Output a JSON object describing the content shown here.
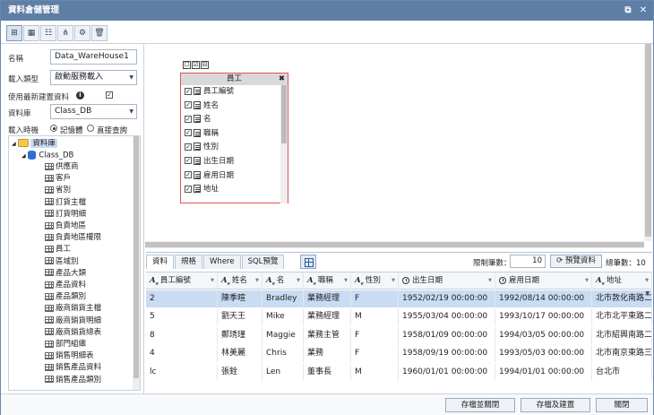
{
  "window": {
    "title": "資料倉儲管理"
  },
  "form": {
    "name_label": "名稱",
    "name_value": "Data_WareHouse1",
    "import_type_label": "載入類型",
    "import_type_value": "啟動服務載入",
    "use_latest_label": "使用最新建置資料",
    "use_latest_checked": "✓",
    "database_label": "資料庫",
    "database_value": "Class_DB",
    "import_timing_label": "載入時機",
    "radio_memory": "記憶體",
    "radio_direct": "直接查詢"
  },
  "tree": {
    "root": "資料庫",
    "db": "Class_DB",
    "tables": [
      "供應商",
      "客戶",
      "省別",
      "訂貨主檔",
      "訂貨明細",
      "負責地區",
      "負責地區權限",
      "員工",
      "區域別",
      "產品大類",
      "產品資料",
      "產品類別",
      "廠商銷貨主檔",
      "廠商銷貨明細",
      "廠商銷貨總表",
      "部門組織",
      "銷售明細表",
      "銷售產品資料",
      "銷售產品類別"
    ]
  },
  "canvas": {
    "mini_icons": [
      "☐",
      "☑",
      "⊟"
    ],
    "table_box": {
      "title": "員工",
      "close": "✖",
      "fields": [
        "員工編號",
        "姓名",
        "名",
        "職稱",
        "性別",
        "出生日期",
        "雇用日期",
        "地址"
      ]
    }
  },
  "bottom": {
    "tabs": [
      "資料",
      "規格",
      "Where",
      "SQL預覽"
    ],
    "limit_label": "限制筆數：",
    "limit_value": "10",
    "preview_button": "預覽資料",
    "preview_icon": "⟳",
    "total_label": "總筆數：10"
  },
  "grid": {
    "columns": [
      {
        "label": "員工編號",
        "type": "A"
      },
      {
        "label": "姓名",
        "type": "A"
      },
      {
        "label": "名",
        "type": "A"
      },
      {
        "label": "職稱",
        "type": "A"
      },
      {
        "label": "性別",
        "type": "A"
      },
      {
        "label": "出生日期",
        "type": "clock"
      },
      {
        "label": "雇用日期",
        "type": "clock"
      },
      {
        "label": "地址",
        "type": "A"
      }
    ],
    "rows": [
      [
        "2",
        "陳季暄",
        "Bradley",
        "業務經理",
        "F",
        "1952/02/19 00:00:00",
        "1992/08/14 00:00:00",
        "北市敦化南路二"
      ],
      [
        "5",
        "劉天王",
        "Mike",
        "業務經理",
        "M",
        "1955/03/04 00:00:00",
        "1993/10/17 00:00:00",
        "北市北平東路二"
      ],
      [
        "8",
        "鄭琇瑾",
        "Maggie",
        "業務主管",
        "F",
        "1958/01/09 00:00:00",
        "1994/03/05 00:00:00",
        "北市紹興南路二"
      ],
      [
        "4",
        "林美麗",
        "Chris",
        "業務",
        "F",
        "1958/09/19 00:00:00",
        "1993/05/03 00:00:00",
        "北市南京東路三"
      ],
      [
        "lc",
        "張銓",
        "Len",
        "董事長",
        "M",
        "1960/01/01 00:00:00",
        "1994/01/01 00:00:00",
        "台北市"
      ]
    ]
  },
  "footer": {
    "save_close": "存檔並關閉",
    "save_build": "存檔及建置",
    "close": "關閉"
  }
}
